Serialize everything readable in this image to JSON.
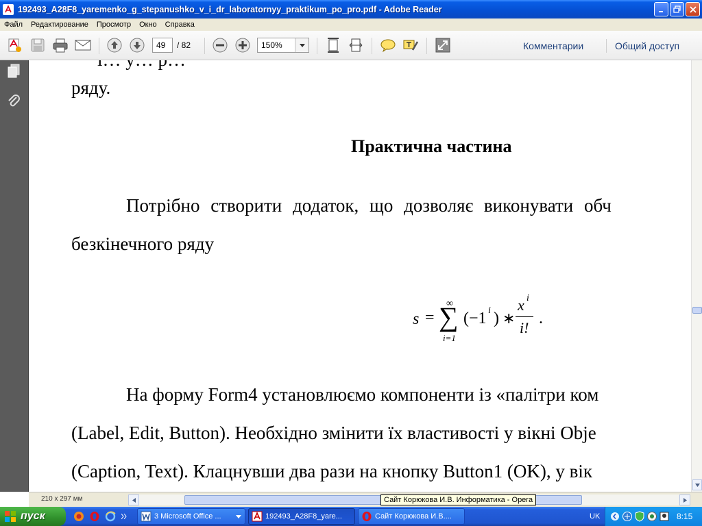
{
  "window": {
    "title": "192493_A28F8_yaremenko_g_stepanushko_v_i_dr_laboratornyy_praktikum_po_pro.pdf - Adobe Reader"
  },
  "menu": {
    "items": [
      "Файл",
      "Редактирование",
      "Просмотр",
      "Окно",
      "Справка"
    ]
  },
  "toolbar": {
    "page_current": "49",
    "page_total": "/ 82",
    "zoom": "150%",
    "comments_label": "Комментарии",
    "share_label": "Общий доступ"
  },
  "document": {
    "cut_line": "і… у… р…",
    "line_top": "ряду.",
    "heading": "Практична частина",
    "para1_line1": "Потрібно створити додаток, що дозволяє виконувати обч",
    "para1_line2": "безкінечного ряду",
    "formula": {
      "lhs": "s",
      "eq": "=",
      "sigma": "∑",
      "upper": "∞",
      "lower": "i=1",
      "term": "(−1",
      "term_exp": "i",
      "term_close": ")",
      "star": "∗",
      "num": "x",
      "num_exp": "i",
      "den": "i!",
      "period": "."
    },
    "para2_line1": "На форму Form4 установлюємо компоненти із «палітри ком",
    "para2_line2": "(Label, Edit, Button). Необхідно змінити їх властивості у вікні Obje",
    "para2_line3": "(Caption, Text). Клацнувши два рази на кнопку Button1 (OK), у вік"
  },
  "status": {
    "page_size": "210 x 297 мм"
  },
  "tooltip": "Сайт Корюкова И.В. Информатика - Opera",
  "taskbar": {
    "start_label": "пуск",
    "tasks": [
      {
        "label": "3 Microsoft Office ...",
        "icon": "word-icon"
      },
      {
        "label": "192493_A28F8_yare...",
        "icon": "pdf-icon"
      },
      {
        "label": "Сайт Корюкова И.В....",
        "icon": "opera-icon"
      }
    ],
    "lang": "UK",
    "clock": "8:15"
  },
  "colors": {
    "title_blue": "#0550d4",
    "taskbar_blue": "#245edb",
    "start_green": "#2f8f2b",
    "nav_gray": "#5b5b5b",
    "link_blue": "#1d3f7a"
  }
}
